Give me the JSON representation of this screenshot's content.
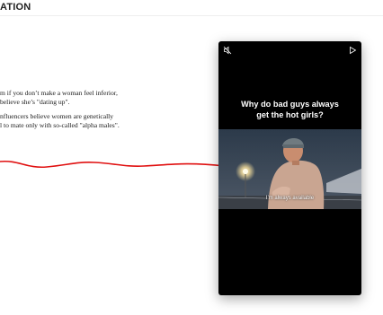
{
  "header": {
    "brand": "ATION"
  },
  "article": {
    "paragraphs": [
      "m if you don’t make a woman feel inferior,",
      "believe she’s \"dating up\".",
      "nfluencers believe women are genetically",
      "l to mate only with so-called \"alpha males\"."
    ]
  },
  "video": {
    "caption": "Why do bad guys always\nget the hot girls?",
    "subtitle": "I'm always available",
    "icons": [
      "mute-icon",
      "play-icon"
    ]
  },
  "colors": {
    "accent_line": "#e01010",
    "video_bg": "#000000"
  }
}
